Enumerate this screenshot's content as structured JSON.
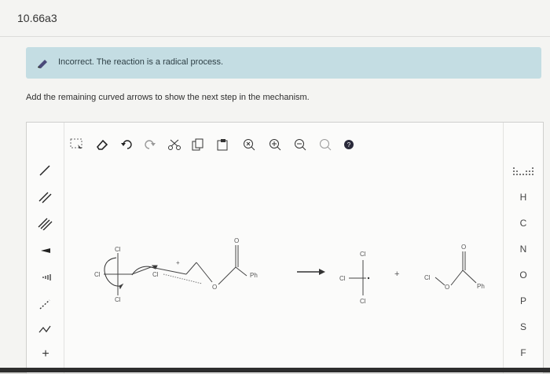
{
  "question_id": "10.66a3",
  "feedback": {
    "message": "Incorrect. The reaction is a radical process.",
    "color": "#c4dde3",
    "icon": "pencil-icon"
  },
  "instruction": "Add the remaining curved arrows to show the next step in the mechanism.",
  "toolbar": {
    "icons": [
      "marquee-select-icon",
      "eraser-icon",
      "undo-icon",
      "redo-icon",
      "cut-icon",
      "copy-icon",
      "paste-icon",
      "zoom-reset-icon",
      "zoom-in-icon",
      "zoom-out-icon",
      "lasso-icon",
      "help-icon"
    ]
  },
  "left_tools": {
    "icons": [
      "single-bond-icon",
      "double-bond-icon",
      "triple-bond-icon",
      "wedge-bond-icon",
      "hash-bond-icon",
      "dashed-bond-icon",
      "chain-tool-icon",
      "charge-plus-icon"
    ],
    "plus_label": "+"
  },
  "right_tools": {
    "periodic_table_icon": "periodic-table-icon",
    "elements": [
      "H",
      "C",
      "N",
      "O",
      "P",
      "S",
      "F"
    ]
  },
  "molecules": {
    "reactant": {
      "cl_top": "Cl",
      "cl_left": "Cl",
      "cl_mid": "Cl",
      "cl_bottom": "Cl",
      "ph": "Ph",
      "o_carbonyl": "O",
      "o_ether": "O"
    },
    "arrow": "→",
    "product1": {
      "cl_top": "Cl",
      "cl_left": "Cl",
      "cl_bottom": "Cl"
    },
    "plus": "+",
    "product2": {
      "cl_left": "Cl",
      "o_ether": "O",
      "o_carbonyl": "O",
      "ph": "Ph"
    }
  }
}
